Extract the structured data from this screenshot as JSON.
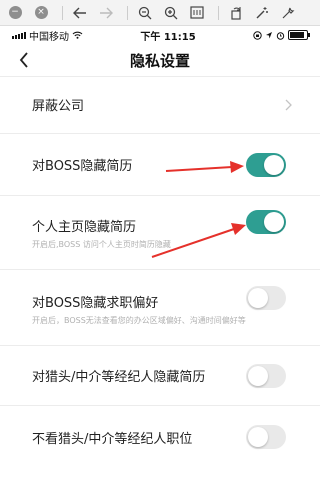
{
  "status_bar": {
    "carrier": "中国移动",
    "time": "下午 11:15"
  },
  "nav": {
    "title": "隐私设置"
  },
  "settings": [
    {
      "label": "屏蔽公司",
      "type": "link"
    },
    {
      "label": "对BOSS隐藏简历",
      "type": "toggle",
      "on": true
    },
    {
      "label": "个人主页隐藏简历",
      "sub": "开启后,BOSS 访问个人主页时简历隐藏",
      "type": "toggle",
      "on": true
    },
    {
      "label": "对BOSS隐藏求职偏好",
      "sub": "开启后，BOSS无法查看您的办公区域偏好、沟通时间偏好等",
      "type": "toggle",
      "on": false
    },
    {
      "label": "对猎头/中介等经纪人隐藏简历",
      "type": "toggle",
      "on": false
    },
    {
      "label": "不看猎头/中介等经纪人职位",
      "type": "toggle",
      "on": false
    }
  ],
  "colors": {
    "toggle_on": "#2e9e92",
    "toggle_off": "#e9e9e9",
    "annotation_arrow": "#e5312b"
  }
}
